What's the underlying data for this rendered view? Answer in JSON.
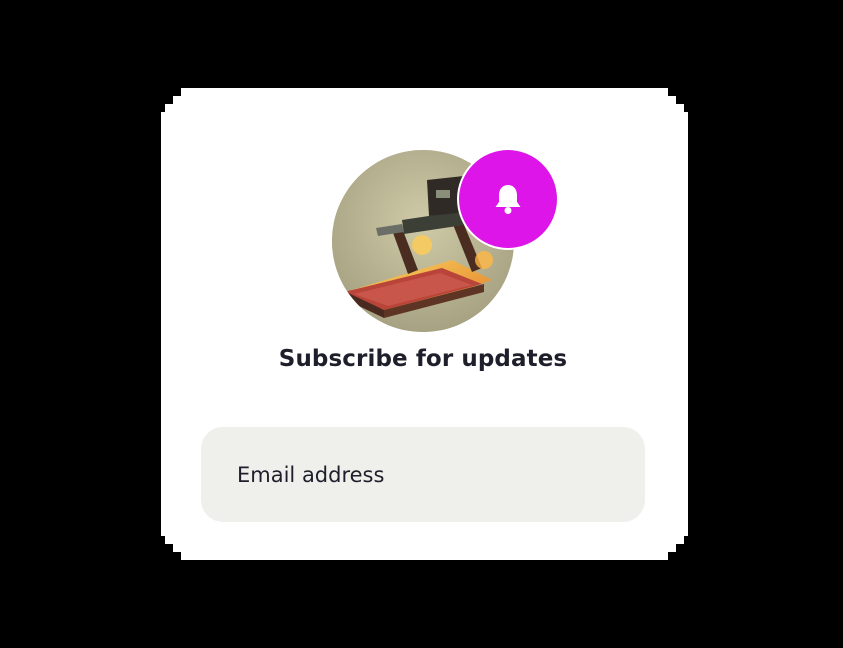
{
  "card": {
    "title": "Subscribe for updates",
    "email_placeholder": "Email address"
  },
  "icons": {
    "badge": "bell-icon",
    "avatar": "treadmill-image"
  },
  "colors": {
    "background": "#000000",
    "card": "#ffffff",
    "badge": "#dd15e8",
    "input_bg": "#efefeb",
    "text": "#1f1f2b"
  }
}
